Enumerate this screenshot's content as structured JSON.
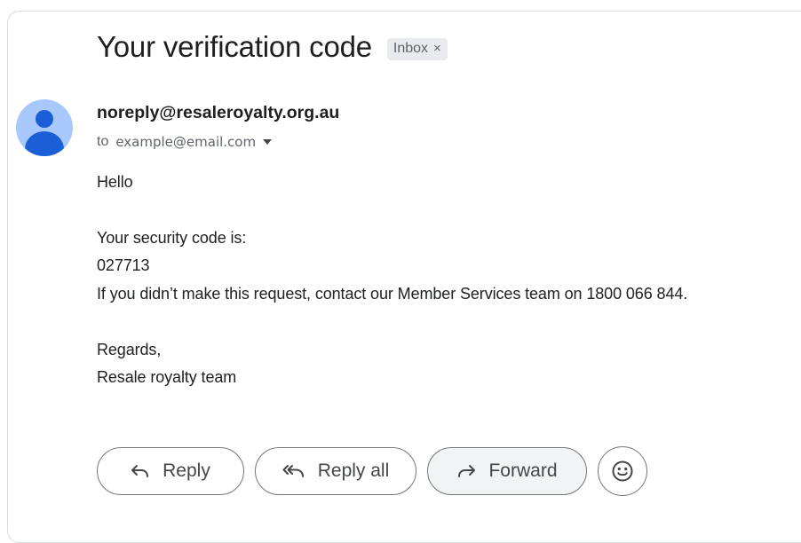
{
  "email": {
    "subject": "Your verification code",
    "label": "Inbox",
    "label_close": "×",
    "sender": "noreply@resaleroyalty.org.au",
    "to_prefix": "to",
    "recipient": "example@email.com",
    "body": {
      "greeting": "Hello",
      "code_intro": "Your security code is:",
      "code": "027713",
      "notice": "If you didn’t make this request, contact our Member Services team on 1800 066 844.",
      "signoff": "Regards,",
      "signature": "Resale royalty team"
    }
  },
  "actions": {
    "reply": "Reply",
    "reply_all": "Reply all",
    "forward": "Forward"
  },
  "icons": {
    "avatar": "person-avatar-icon",
    "reply": "reply-arrow-icon",
    "reply_all": "reply-all-arrow-icon",
    "forward": "forward-arrow-icon",
    "emoji": "smiley-emoji-icon",
    "recipient_menu": "caret-down-icon"
  },
  "colors": {
    "avatar_bg": "#a8c7fa",
    "avatar_fg": "#1a5fd8",
    "label_chip_bg": "#e8eaed",
    "button_border": "#747775",
    "forward_button_bg": "#f1f3f4"
  }
}
